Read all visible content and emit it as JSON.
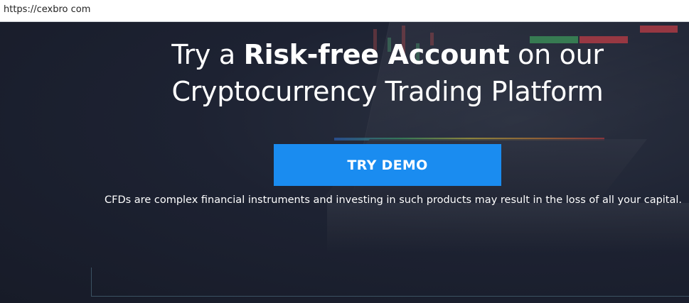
{
  "browser": {
    "url": "https://cexbro com"
  },
  "hero": {
    "headline_pre": "Try a ",
    "headline_bold": "Risk-free Account",
    "headline_post": " on our",
    "headline_line2": "Cryptocurrency Trading Platform",
    "cta_label": "TRY DEMO",
    "disclaimer": "CFDs are complex financial instruments and investing in such products may result in the loss of all your capital."
  },
  "colors": {
    "background": "#1a1f2e",
    "cta": "#1a8cf0",
    "text": "#ffffff"
  }
}
